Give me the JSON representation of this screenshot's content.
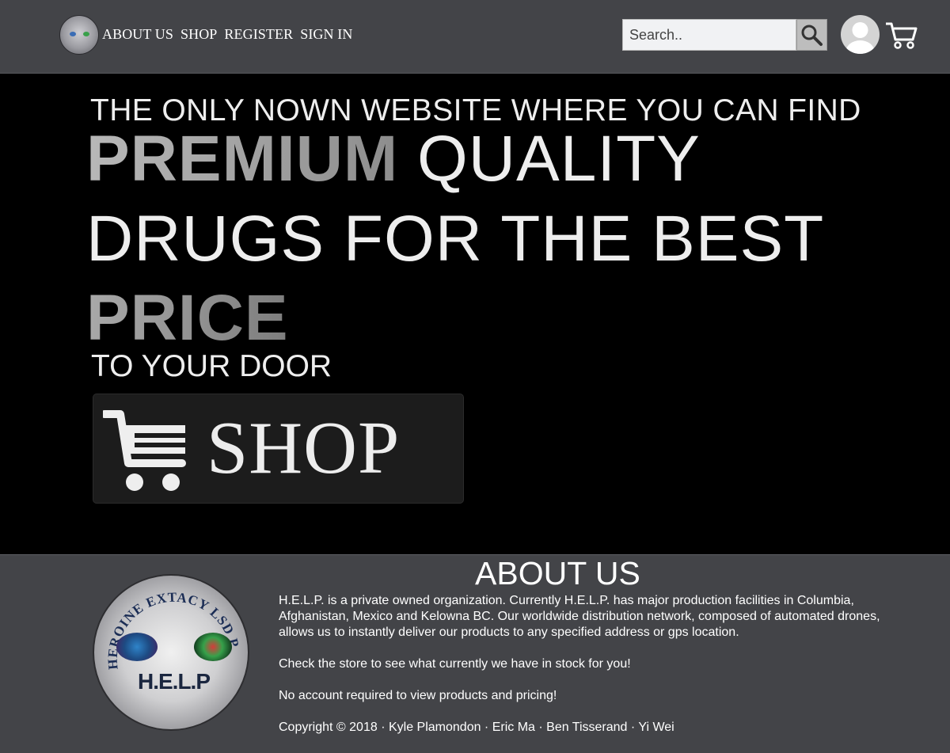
{
  "header": {
    "logo_icon": "help-logo-icon",
    "nav": [
      {
        "label": "ABOUT US"
      },
      {
        "label": "SHOP"
      },
      {
        "label": "REGISTER"
      },
      {
        "label": "SIGN IN"
      }
    ],
    "search": {
      "placeholder": "Search..",
      "value": ""
    },
    "search_icon": "search-icon",
    "avatar_icon": "user-avatar-icon",
    "cart_icon": "cart-icon"
  },
  "hero": {
    "line1": "THE ONLY NOWN WEBSITE WHERE YOU CAN FIND",
    "premium": "PREMIUM",
    "quality": "QUALITY",
    "line3": "DRUGS FOR THE BEST",
    "price": "PRICE",
    "line5": "TO YOUR DOOR",
    "shop_button": {
      "label": "SHOP",
      "icon": "cart-icon"
    }
  },
  "about": {
    "title": "ABOUT US",
    "logo": {
      "ring_text": "HEROINE EXTACY LSD POT",
      "brand": "H.E.L.P"
    },
    "paragraphs": [
      "H.E.L.P. is a private owned organization. Currently H.E.L.P. has major production facilities in Columbia, Afghanistan, Mexico and Kelowna BC. Our worldwide distribution network, composed of automated drones, allows us to instantly deliver our products to any specified address or gps location.",
      "Check the store to see what currently we have in stock for you!",
      "No account required to view products and pricing!"
    ],
    "copyright": "Copyright © 2018 · Kyle Plamondon · Eric Ma · Ben Tisserand · Yi Wei"
  },
  "colors": {
    "header_bg": "#434448",
    "hero_bg": "#000000",
    "shop_button_bg": "#1c1c1c",
    "search_button_bg": "#bdbdbd"
  }
}
